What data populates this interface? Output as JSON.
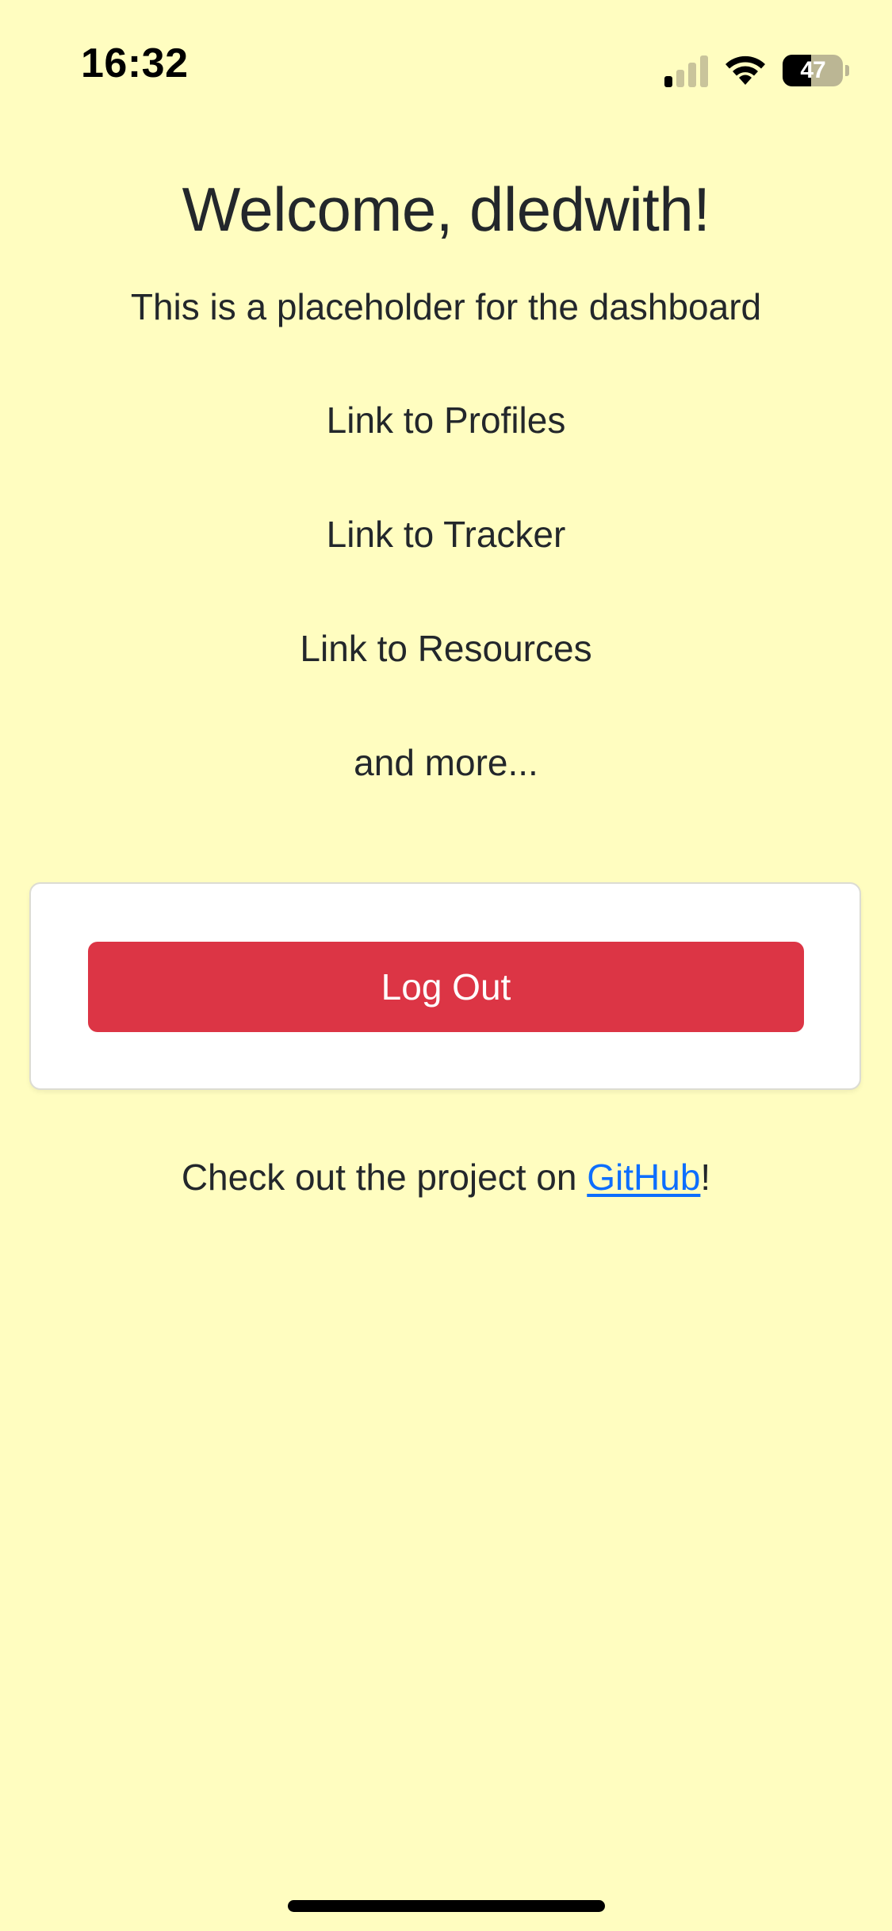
{
  "status_bar": {
    "time": "16:32",
    "signal_bars_active": 1,
    "signal_bars_total": 4,
    "battery_level": "47",
    "battery_fraction": 0.47,
    "icons": [
      "cellular-signal-icon",
      "wifi-icon",
      "battery-icon"
    ]
  },
  "main": {
    "title": "Welcome, dledwith!",
    "subtitle": "This is a placeholder for the dashboard",
    "links": [
      {
        "label": "Link to Profiles"
      },
      {
        "label": "Link to Tracker"
      },
      {
        "label": "Link to Resources"
      }
    ],
    "more_text": "and more..."
  },
  "logout": {
    "label": "Log Out"
  },
  "footer": {
    "text_before": "Check out the project on ",
    "link_label": "GitHub",
    "text_after": "!"
  },
  "colors": {
    "background": "#fffdc0",
    "text": "#23272b",
    "danger_button": "#dc3545",
    "link": "#0d6efd"
  }
}
